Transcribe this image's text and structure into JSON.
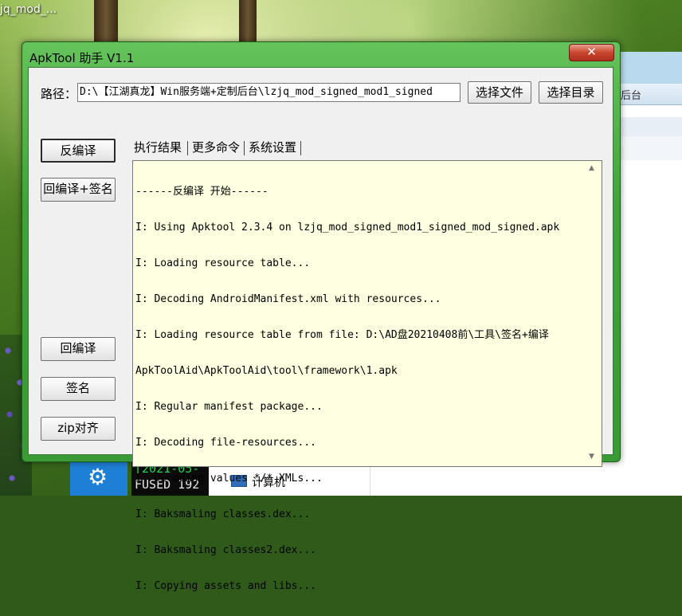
{
  "desktop": {
    "icon_label": "jq_mod_...",
    "background_window_label": "后台",
    "console_lines": [
      "[2021-05-",
      "FUSED 192"
    ],
    "explorer_item_label": "计算机",
    "settings_icon": "gear-icon"
  },
  "dialog": {
    "title": "ApkTool 助手 V1.1",
    "close_label": "✕",
    "path_label": "路径：",
    "path_value": "D:\\【江湖真龙】Win服务端+定制后台\\lzjq_mod_signed_mod1_signed",
    "select_file_label": "选择文件",
    "select_dir_label": "选择目录",
    "side_buttons": {
      "decompile": "反编译",
      "recompile_sign": "回编译+签名",
      "recompile": "回编译",
      "sign": "签名",
      "zipalign": "zip对齐"
    },
    "tabs": [
      "执行结果",
      "更多命令",
      "系统设置"
    ],
    "log_lines": [
      "------反编译 开始------",
      "I: Using Apktool 2.3.4 on lzjq_mod_signed_mod1_signed_mod_signed.apk",
      "I: Loading resource table...",
      "I: Decoding AndroidManifest.xml with resources...",
      "I: Loading resource table from file: D:\\AD盘20210408前\\工具\\签名+编译",
      "ApkToolAid\\ApkToolAid\\tool\\framework\\1.apk",
      "I: Regular manifest package...",
      "I: Decoding file-resources...",
      "I: Decoding values */* XMLs...",
      "I: Baksmaling classes.dex...",
      "I: Baksmaling classes2.dex...",
      "I: Copying assets and libs..."
    ]
  }
}
